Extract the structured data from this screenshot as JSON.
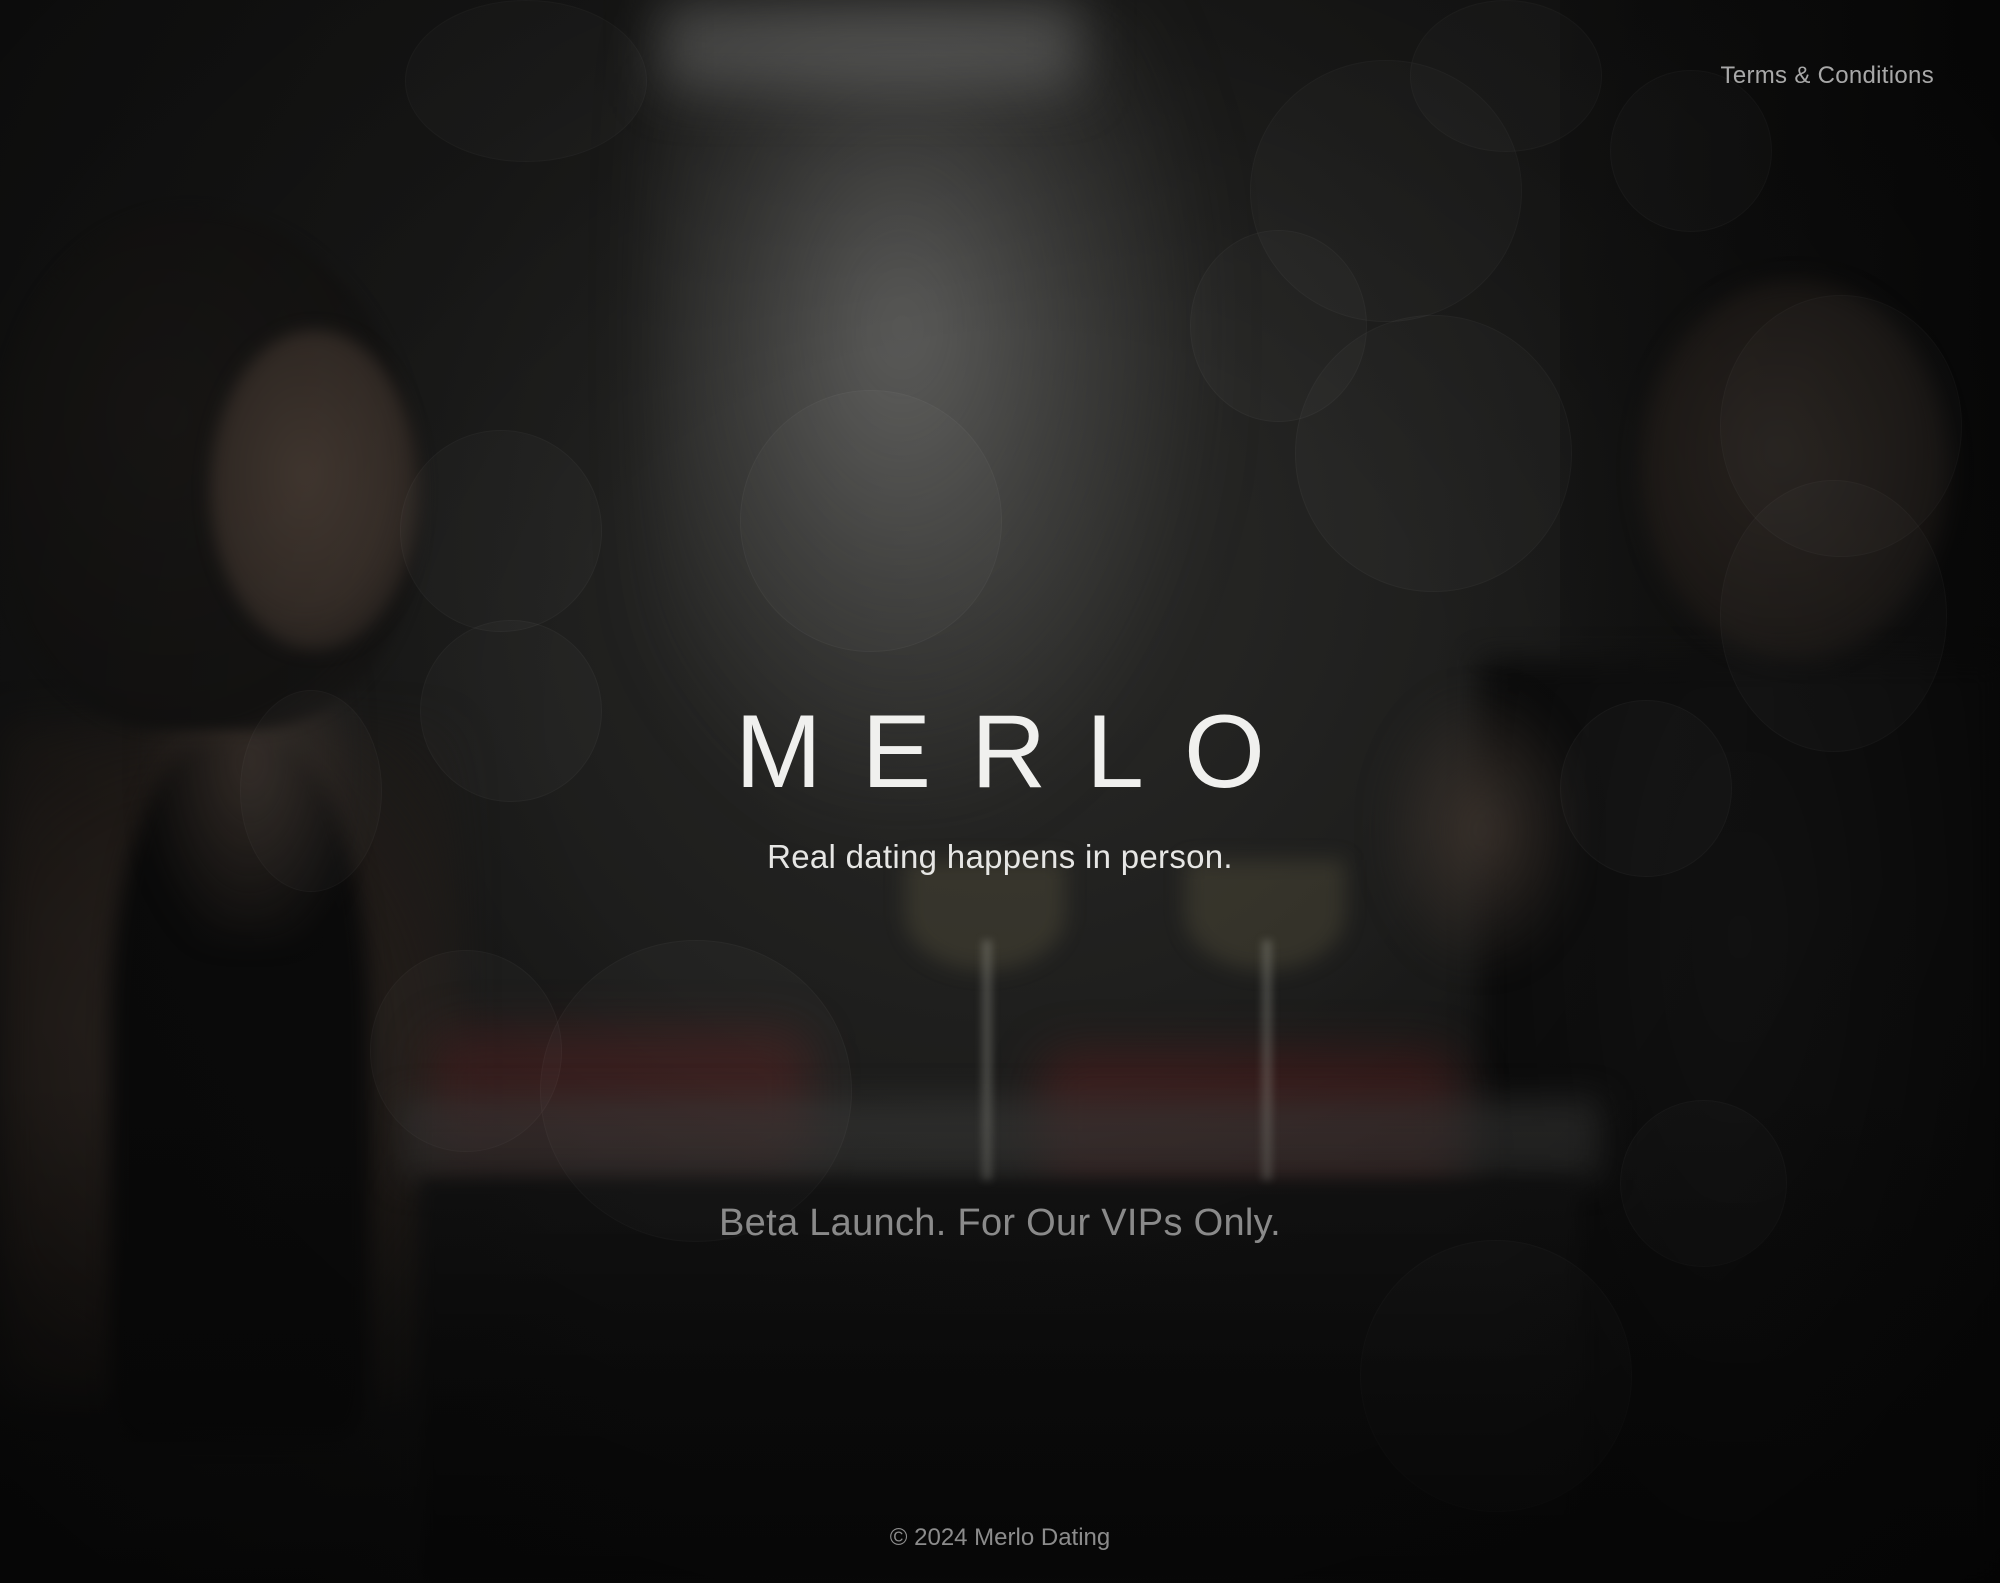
{
  "header": {
    "terms_link_label": "Terms & Conditions"
  },
  "hero": {
    "logo_text": "MERLO",
    "tagline": "Real dating happens in person."
  },
  "announcement": {
    "text": "Beta Launch. For Our VIPs Only."
  },
  "footer": {
    "copyright": "© 2024 Merlo Dating"
  },
  "colors": {
    "background_overlay": "#1a1a19",
    "logo": "#f0f0ee",
    "tagline": "#e6e6e4",
    "muted_text": "#8a8a8a"
  }
}
